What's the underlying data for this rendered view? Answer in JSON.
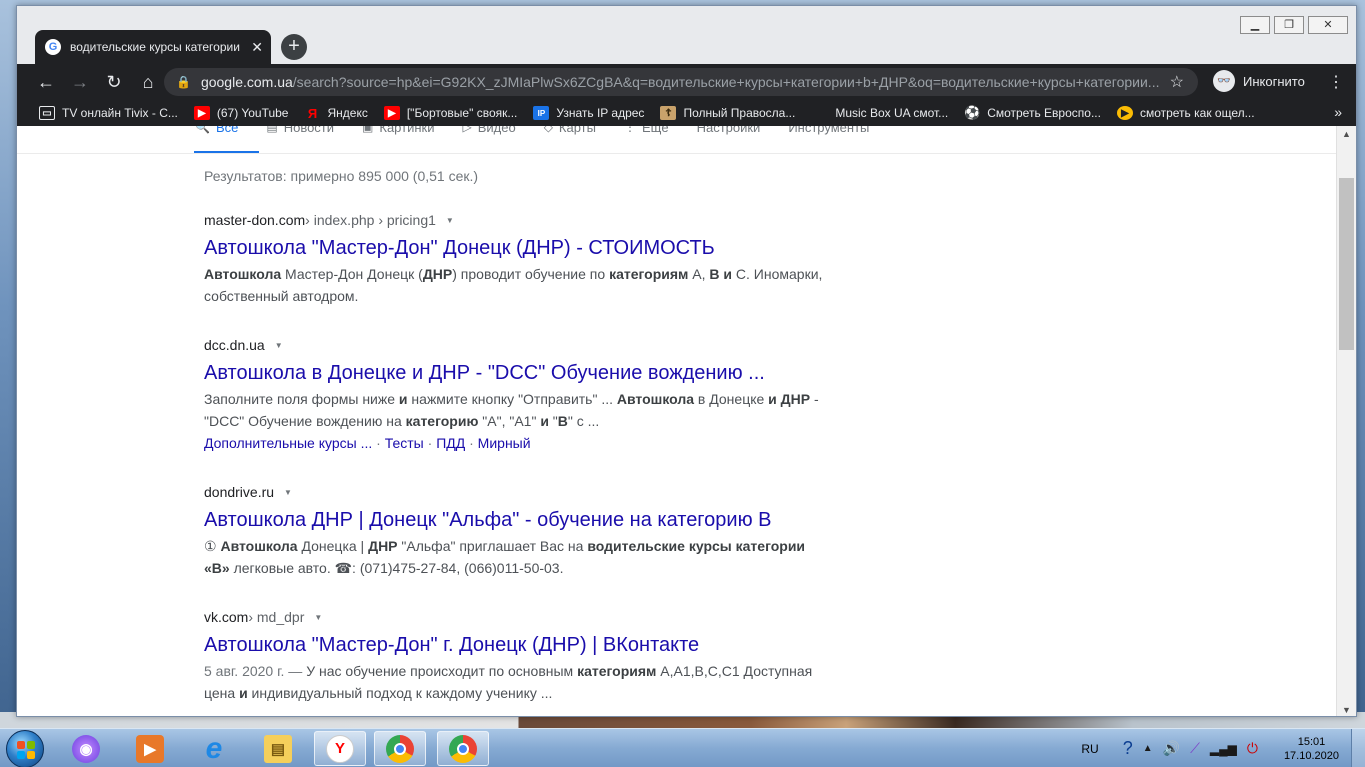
{
  "browser": {
    "tab_title": "водительские курсы категории",
    "tab_favicon_letter": "G",
    "new_tab_symbol": "+",
    "url_domain": "google.com.ua",
    "url_rest": "/search?source=hp&ei=G92KX_zJMIaPlwSx6ZCgBA&q=водительские+курсы+категории+b+ДНР&oq=водительские+курсы+категории...",
    "incognito_label": "Инкогнито"
  },
  "bookmarks": [
    {
      "label": "TV онлайн Tivix - С...",
      "icon": "tv-icon",
      "color": "#3c4043"
    },
    {
      "label": "(67) YouTube",
      "icon": "youtube-icon",
      "color": "#ff0000"
    },
    {
      "label": "Яндекс",
      "icon": "yandex-icon",
      "color": "#ff0000"
    },
    {
      "label": "[\"Бортовые\" свояк...",
      "icon": "youtube-icon",
      "color": "#ff0000"
    },
    {
      "label": "Узнать IP адрес",
      "icon": "ip-icon",
      "color": "#1a73e8"
    },
    {
      "label": "Полный Правосла...",
      "icon": "cross-icon",
      "color": "#c9a26b"
    },
    {
      "label": "Music Box UA смот...",
      "icon": "none",
      "color": ""
    },
    {
      "label": "Смотреть Евроспо...",
      "icon": "football-icon",
      "color": "#e8eaed"
    },
    {
      "label": "смотреть как ощел...",
      "icon": "play-icon",
      "color": "#fbbc04"
    }
  ],
  "search": {
    "tabs": [
      {
        "label": "Все",
        "icon": "search-icon",
        "active": true
      },
      {
        "label": "Новости",
        "icon": "news-icon",
        "active": false
      },
      {
        "label": "Картинки",
        "icon": "image-icon",
        "active": false
      },
      {
        "label": "Видео",
        "icon": "video-icon",
        "active": false
      },
      {
        "label": "Карты",
        "icon": "map-pin-icon",
        "active": false
      },
      {
        "label": "Ещё",
        "icon": "more-icon",
        "active": false
      },
      {
        "label": "Настройки",
        "icon": "none",
        "active": false
      },
      {
        "label": "Инструменты",
        "icon": "none",
        "active": false
      }
    ],
    "stats": "Результатов: примерно 895 000 (0,51 сек.)"
  },
  "results": [
    {
      "domain": "master-don.com",
      "crumb": " › index.php › pricing1",
      "title": "Автошкола \"Мастер-Дон\" Донецк (ДНР) - СТОИМОСТЬ",
      "snippet_html": "<b>Автошкола</b> Мастер-Дон Донецк (<b>ДНР</b>) проводит обучение по <b>категориям</b> А, <b>В</b> <b>и</b> С. Иномарки, собственный автодром."
    },
    {
      "domain": "dcc.dn.ua",
      "crumb": "",
      "title": "Автошкола в Донецке и ДНР - \"DCC\" Обучение вождению ...",
      "snippet_html": "Заполните поля формы ниже <b>и</b> нажмите кнопку \"Отправить\" ... <b>Автошкола</b> в Донецке <b>и ДНР</b> - \"DCC\" Обучение вождению на <b>категорию</b> \"A\", \"A1\" <b>и</b> \"<b>B</b>\" с ...",
      "links": [
        "Дополнительные курсы ...",
        "Тесты",
        "ПДД",
        "Мирный"
      ]
    },
    {
      "domain": "dondrive.ru",
      "crumb": "",
      "title": "Автошкола ДНР | Донецк \"Альфа\" - обучение на категорию В",
      "snippet_html": "① <b>Автошкола</b> Донецка | <b>ДНР</b> \"Альфа\" приглашает Вас на <b>водительские курсы категории «В»</b> легковые авто. ☎: (071)475-27-84, (066)011-50-03."
    },
    {
      "domain": "vk.com",
      "crumb": " › md_dpr",
      "title": "Автошкола \"Мастер-Дон\" г. Донецк (ДНР) | ВКонтакте",
      "snippet_html": "<span style=\"color:#70757a\">5 авг. 2020 г. — </span>У нас обучение происходит по основным <b>категориям</b> A,A1,B,C,C1 Доступная цена <b>и</b> индивидуальный подход к каждому ученику ..."
    }
  ],
  "taskbar": {
    "lang": "RU",
    "time": "15:01",
    "date": "17.10.2020",
    "apps": [
      "alice-icon",
      "media-player-icon",
      "internet-explorer-icon",
      "file-explorer-icon",
      "yandex-browser-icon",
      "chrome-icon",
      "chrome-icon"
    ]
  }
}
